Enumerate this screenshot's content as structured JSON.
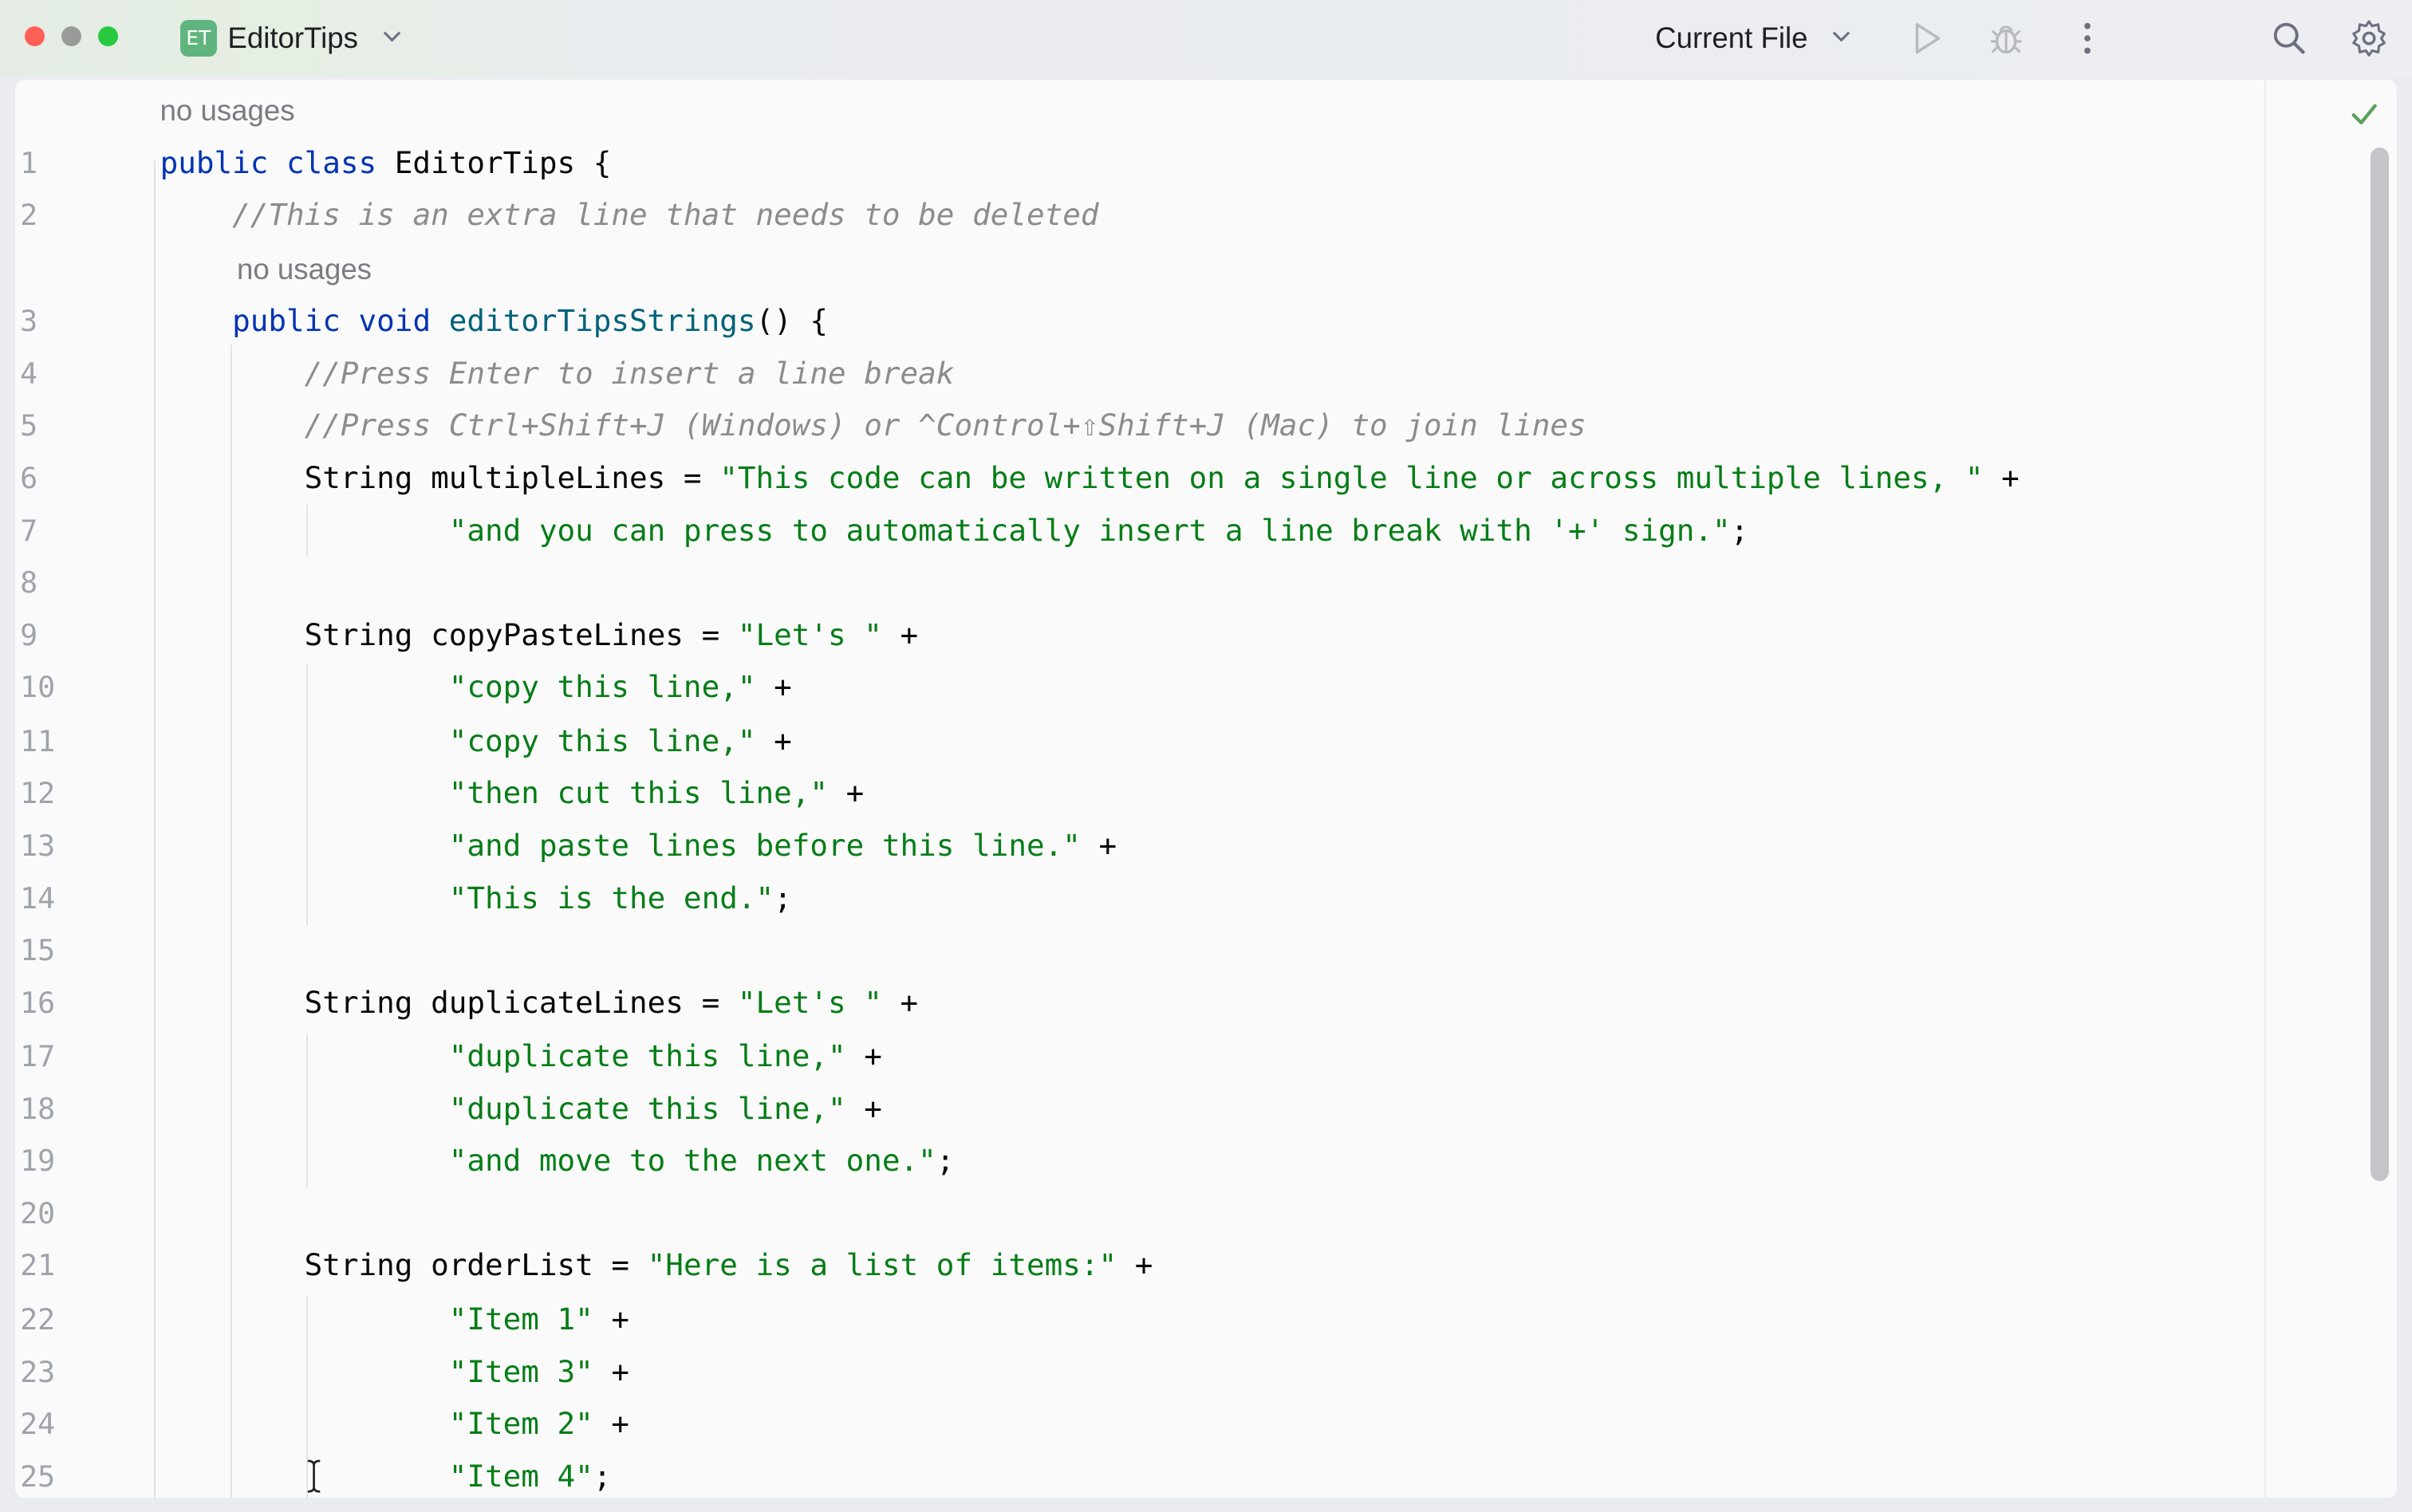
{
  "window": {
    "project_badge": "ET",
    "project_name": "EditorTips",
    "run_config": "Current File"
  },
  "toolbar": {
    "icons": [
      "run-icon",
      "debug-icon",
      "more-icon",
      "search-icon",
      "settings-icon"
    ]
  },
  "editor": {
    "inspection_status": "check-icon",
    "usage_hints": [
      "no usages",
      "no usages"
    ],
    "line_numbers": [
      "1",
      "2",
      "3",
      "4",
      "5",
      "6",
      "7",
      "8",
      "9",
      "10",
      "11",
      "12",
      "13",
      "14",
      "15",
      "16",
      "17",
      "18",
      "19",
      "20",
      "21",
      "22",
      "23",
      "24",
      "25"
    ],
    "lines": [
      [
        [
          "kw",
          "public class "
        ],
        [
          "",
          "EditorTips {"
        ]
      ],
      [
        [
          "",
          "    "
        ],
        [
          "cmt",
          "//This is an extra line that needs to be deleted"
        ]
      ],
      [
        [
          "",
          "    "
        ],
        [
          "kw",
          "public void "
        ],
        [
          "fn",
          "editorTipsStrings"
        ],
        [
          "",
          "() {"
        ]
      ],
      [
        [
          "",
          "        "
        ],
        [
          "cmt",
          "//Press Enter to insert a line break"
        ]
      ],
      [
        [
          "",
          "        "
        ],
        [
          "cmt",
          "//Press Ctrl+Shift+J (Windows) or ^Control+⇧Shift+J (Mac) to join lines"
        ]
      ],
      [
        [
          "",
          "        String multipleLines = "
        ],
        [
          "str",
          "\"This code can be written on a single line or across multiple lines, \""
        ],
        [
          "",
          " +"
        ]
      ],
      [
        [
          "",
          "                "
        ],
        [
          "str",
          "\"and you can press to automatically insert a line break with '+' sign.\""
        ],
        [
          "",
          ";"
        ]
      ],
      [
        [
          "",
          ""
        ]
      ],
      [
        [
          "",
          "        String copyPasteLines = "
        ],
        [
          "str",
          "\"Let's \""
        ],
        [
          "",
          " +"
        ]
      ],
      [
        [
          "",
          "                "
        ],
        [
          "str",
          "\"copy this line,\""
        ],
        [
          "",
          " +"
        ]
      ],
      [
        [
          "",
          "                "
        ],
        [
          "str",
          "\"copy this line,\""
        ],
        [
          "",
          " +"
        ]
      ],
      [
        [
          "",
          "                "
        ],
        [
          "str",
          "\"then cut this line,\""
        ],
        [
          "",
          " +"
        ]
      ],
      [
        [
          "",
          "                "
        ],
        [
          "str",
          "\"and paste lines before this line.\""
        ],
        [
          "",
          " +"
        ]
      ],
      [
        [
          "",
          "                "
        ],
        [
          "str",
          "\"This is the end.\""
        ],
        [
          "",
          ";"
        ]
      ],
      [
        [
          "",
          ""
        ]
      ],
      [
        [
          "",
          "        String duplicateLines = "
        ],
        [
          "str",
          "\"Let's \""
        ],
        [
          "",
          " +"
        ]
      ],
      [
        [
          "",
          "                "
        ],
        [
          "str",
          "\"duplicate this line,\""
        ],
        [
          "",
          " +"
        ]
      ],
      [
        [
          "",
          "                "
        ],
        [
          "str",
          "\"duplicate this line,\""
        ],
        [
          "",
          " +"
        ]
      ],
      [
        [
          "",
          "                "
        ],
        [
          "str",
          "\"and move to the next one.\""
        ],
        [
          "",
          ";"
        ]
      ],
      [
        [
          "",
          ""
        ]
      ],
      [
        [
          "",
          "        String orderList = "
        ],
        [
          "str",
          "\"Here is a list of items:\""
        ],
        [
          "",
          " +"
        ]
      ],
      [
        [
          "",
          "                "
        ],
        [
          "str",
          "\"Item 1\""
        ],
        [
          "",
          " +"
        ]
      ],
      [
        [
          "",
          "                "
        ],
        [
          "str",
          "\"Item 3\""
        ],
        [
          "",
          " +"
        ]
      ],
      [
        [
          "",
          "                "
        ],
        [
          "str",
          "\"Item 2\""
        ],
        [
          "",
          " +"
        ]
      ],
      [
        [
          "",
          "                "
        ],
        [
          "str",
          "\"Item 4\""
        ],
        [
          "",
          ";"
        ]
      ]
    ],
    "cursor": "text-cursor-icon"
  },
  "colors": {
    "keyword": "#0033b3",
    "string": "#067d17",
    "comment": "#8c8c8c",
    "method": "#00627a",
    "badge": "#5fb57d"
  }
}
